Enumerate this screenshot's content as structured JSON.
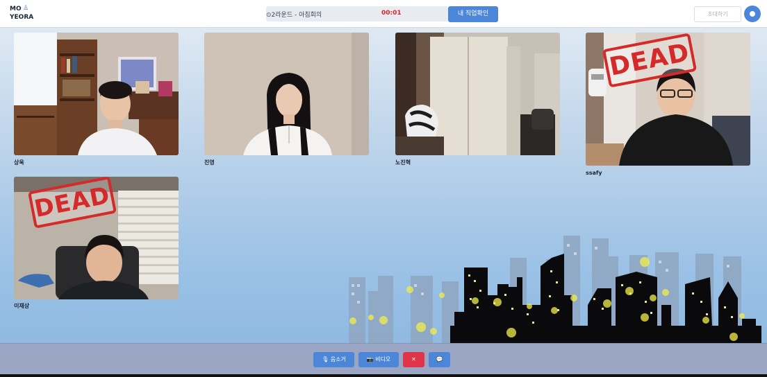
{
  "header": {
    "logo_line1": "MO",
    "logo_line2": "YEORA",
    "round_text": "⊙2라운드 - 아침회의",
    "timer": "00:01",
    "job_button": "내 직업확인",
    "invite_button": "초대하기"
  },
  "participants": [
    {
      "name": "상욱",
      "dead": false
    },
    {
      "name": "진영",
      "dead": false
    },
    {
      "name": "노진혁",
      "dead": false
    },
    {
      "name": "ssafy",
      "dead": true
    },
    {
      "name": "이재상",
      "dead": true
    }
  ],
  "dead_stamp_text": "DEAD",
  "controls": {
    "mute": "🎙 음소거",
    "video": "📷 비디오",
    "leave": "✕",
    "chat": "💬"
  },
  "colors": {
    "accent": "#4c86d8",
    "danger": "#e0344a",
    "timer": "#e02424",
    "dead": "#d42a2a"
  }
}
